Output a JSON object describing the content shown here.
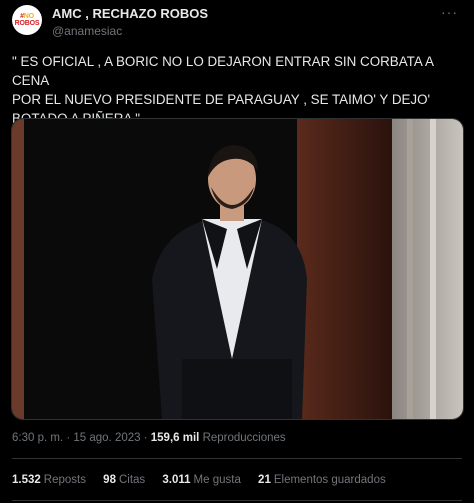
{
  "author": {
    "display_name": "AMC , RECHAZO ROBOS",
    "handle": "@anamesiac",
    "avatar_icon": "avatar-logo-icon"
  },
  "more_icon": "more-options-icon",
  "tweet": {
    "text": "\" ES OFICIAL , A BORIC NO LO DEJARON ENTRAR SIN CORBATA A CENA\nPOR EL NUEVO PRESIDENTE DE PARAGUAY , SE TAIMO' Y DEJO'\nBOTADO A PIÑERA \""
  },
  "meta": {
    "time": "6:30 p. m.",
    "sep1": " · ",
    "date": "15 ago. 2023",
    "sep2": " · ",
    "views_count": "159,6 mil",
    "views_label": "Reproducciones"
  },
  "stats": {
    "reposts_count": "1.532",
    "reposts_label": "Reposts",
    "quotes_count": "98",
    "quotes_label": "Citas",
    "likes_count": "3.011",
    "likes_label": "Me gusta",
    "bookmarks_count": "21",
    "bookmarks_label": "Elementos guardados"
  },
  "colors": {
    "background": "#000000",
    "text_primary": "#e7e9ea",
    "text_secondary": "#71767b",
    "border": "#2f3336"
  }
}
